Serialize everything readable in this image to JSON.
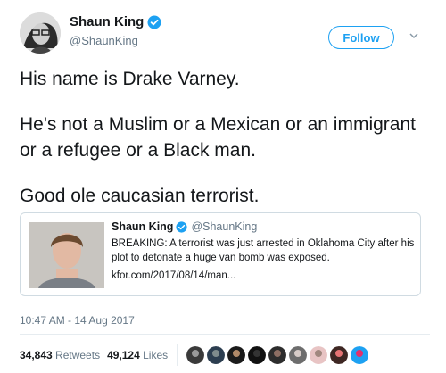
{
  "author": {
    "name": "Shaun King",
    "handle": "@ShaunKing"
  },
  "follow_label": "Follow",
  "tweet": {
    "line1": "His name is Drake Varney.",
    "line2": "He's not a Muslim or a Mexican or an immigrant or a refugee or a Black man.",
    "line3": "Good ole caucasian terrorist."
  },
  "quote": {
    "name": "Shaun King",
    "handle": "@ShaunKing",
    "text": "BREAKING: A terrorist was just arrested in Oklahoma City after his plot to detonate a huge van bomb was exposed.",
    "link": "kfor.com/2017/08/14/man..."
  },
  "timestamp": "10:47 AM - 14 Aug 2017",
  "stats": {
    "retweets_count": "34,843",
    "retweets_label": "Retweets",
    "likes_count": "49,124",
    "likes_label": "Likes"
  },
  "colors": {
    "accent": "#1da1f2",
    "text": "#14171a",
    "muted": "#657786"
  }
}
